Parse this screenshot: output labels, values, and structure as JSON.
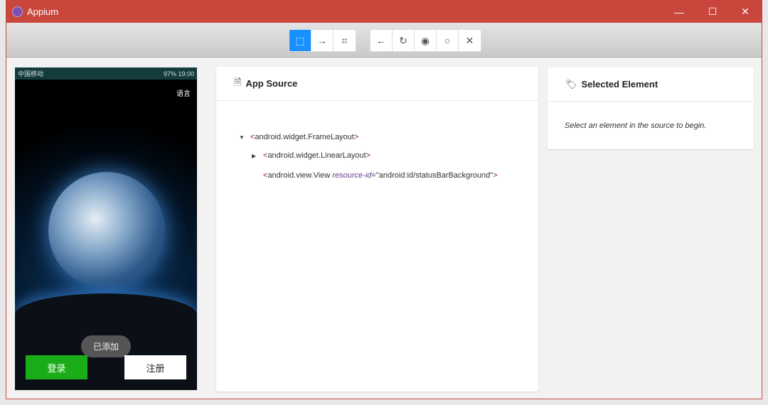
{
  "window": {
    "title": "Appium",
    "minimize": "—",
    "maximize": "☐",
    "close": "✕"
  },
  "toolbar": {
    "group1": [
      {
        "name": "select-element",
        "glyph": "⬚"
      },
      {
        "name": "swipe",
        "glyph": "→"
      },
      {
        "name": "tap-coordinates",
        "glyph": "⌗"
      }
    ],
    "group2": [
      {
        "name": "back",
        "glyph": "←"
      },
      {
        "name": "refresh",
        "glyph": "↻"
      },
      {
        "name": "show-hide",
        "glyph": "◉"
      },
      {
        "name": "search",
        "glyph": "○"
      },
      {
        "name": "quit",
        "glyph": "✕"
      }
    ]
  },
  "phone": {
    "carrier": "中国移动",
    "status": "97%  19:00",
    "language": "语言",
    "toast": "已添加",
    "login": "登录",
    "register": "注册"
  },
  "source": {
    "title": "App Source",
    "nodes": [
      {
        "tag": "android.widget.FrameLayout"
      },
      {
        "tag": "android.widget.LinearLayout"
      },
      {
        "tag": "android.view.View",
        "attr": "resource-id",
        "value": "\"android:id/statusBarBackground\""
      }
    ]
  },
  "selected": {
    "title": "Selected Element",
    "hint": "Select an element in the source to begin."
  }
}
